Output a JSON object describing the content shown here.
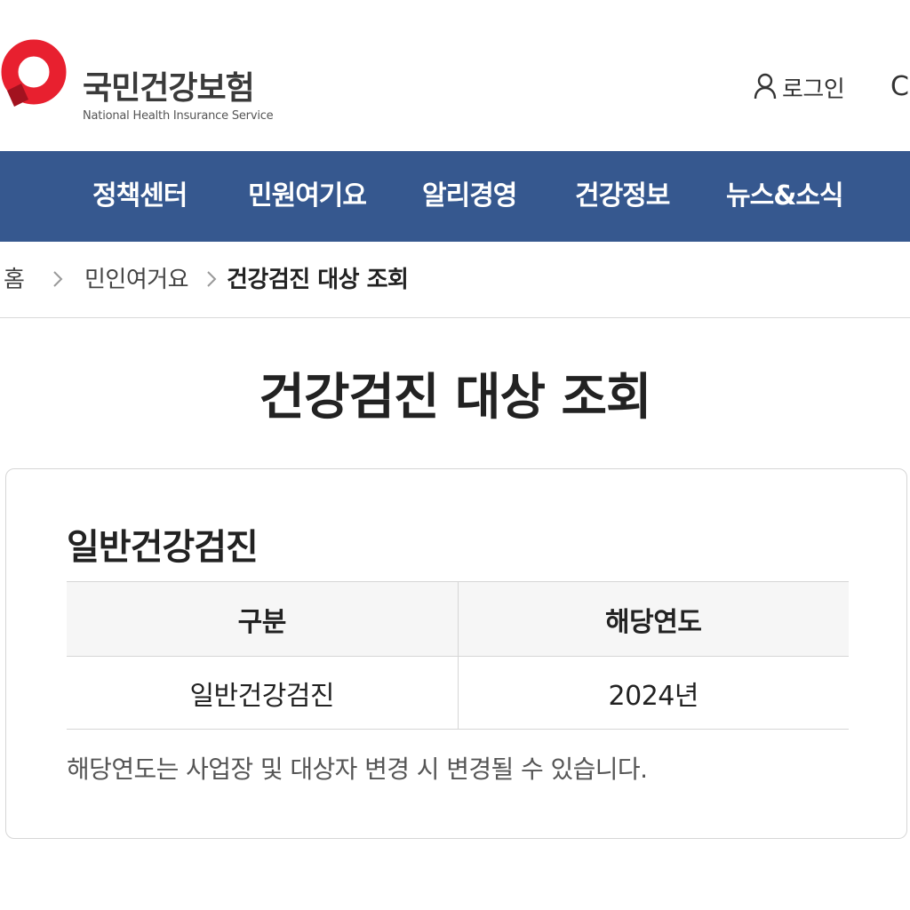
{
  "header": {
    "logo_ko": "국민건강보험",
    "logo_en": "National Health Insurance Service",
    "login_label": "로그인",
    "cut_text": "C",
    "logo_icon": "nhis-logo-mark",
    "user_icon": "user-icon"
  },
  "nav": {
    "items": [
      {
        "label": "정책센터"
      },
      {
        "label": "민원여기요"
      },
      {
        "label": "알리경영"
      },
      {
        "label": "건강정보"
      },
      {
        "label": "뉴스&소식"
      }
    ]
  },
  "breadcrumb": {
    "home": "홈",
    "level1": "민인여거요",
    "current": "건강검진 대상 조회",
    "separator_icon": "chevron-right-icon"
  },
  "page": {
    "title": "건강검진 대상 조회"
  },
  "section": {
    "title": "일반건강검진",
    "table": {
      "headers": [
        "구분",
        "해당연도"
      ],
      "rows": [
        [
          "일반건강검진",
          "2024년"
        ]
      ]
    },
    "notice": "해당연도는 사업장 및 대상자 변경 시 변경될 수 있습니다."
  },
  "colors": {
    "nav_bg": "#36588f",
    "logo_red": "#e8202f",
    "logo_dark_red": "#a2121f"
  }
}
